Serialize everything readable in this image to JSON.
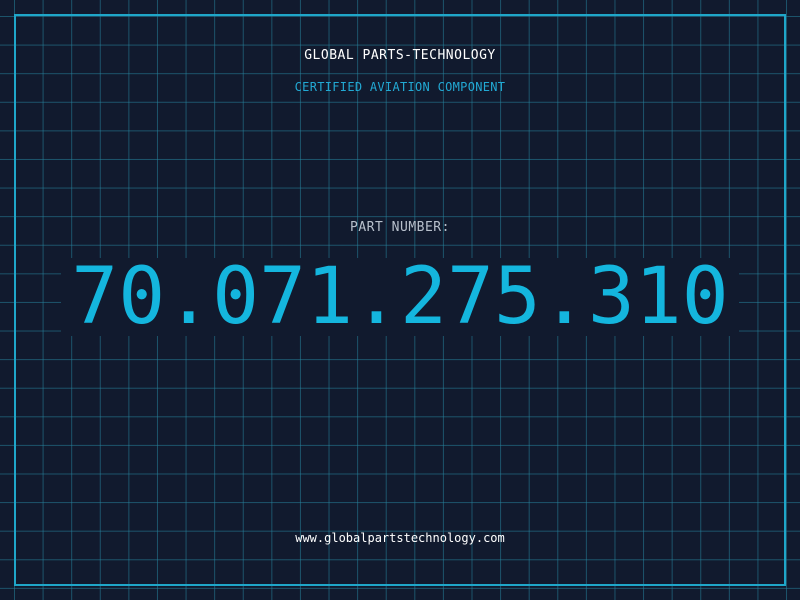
{
  "header": {
    "brand": "GLOBAL PARTS-TECHNOLOGY",
    "tagline": "CERTIFIED AVIATION COMPONENT"
  },
  "part": {
    "label": "PART NUMBER:",
    "number": "70.071.275.310"
  },
  "footer": {
    "url": "www.globalpartstechnology.com"
  },
  "colors": {
    "background": "#111a2e",
    "grid": "#26849e",
    "accent": "#14b6de",
    "frame": "#1fa6c9"
  }
}
